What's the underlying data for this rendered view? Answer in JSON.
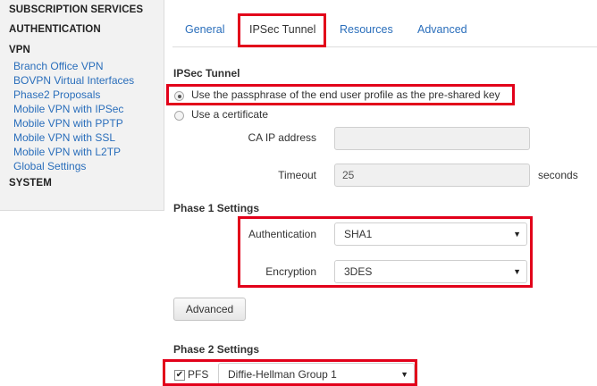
{
  "sidebar": {
    "sections": [
      {
        "label": "SUBSCRIPTION SERVICES"
      },
      {
        "label": "AUTHENTICATION"
      },
      {
        "label": "VPN"
      }
    ],
    "vpn_items": [
      "Branch Office VPN",
      "BOVPN Virtual Interfaces",
      "Phase2 Proposals",
      "Mobile VPN with IPSec",
      "Mobile VPN with PPTP",
      "Mobile VPN with SSL",
      "Mobile VPN with L2TP",
      "Global Settings"
    ],
    "system_label": "SYSTEM"
  },
  "tabs": [
    {
      "label": "General",
      "active": false
    },
    {
      "label": "IPSec Tunnel",
      "active": true
    },
    {
      "label": "Resources",
      "active": false
    },
    {
      "label": "Advanced",
      "active": false
    }
  ],
  "ipsec": {
    "heading": "IPSec Tunnel",
    "option_passphrase": "Use the passphrase of the end user profile as the pre-shared key",
    "option_certificate": "Use a certificate",
    "selected_option": "passphrase",
    "ca_ip_label": "CA IP address",
    "ca_ip_value": "",
    "timeout_label": "Timeout",
    "timeout_value": "25",
    "timeout_unit": "seconds"
  },
  "phase1": {
    "heading": "Phase 1 Settings",
    "authentication_label": "Authentication",
    "authentication_value": "SHA1",
    "encryption_label": "Encryption",
    "encryption_value": "3DES",
    "advanced_button": "Advanced"
  },
  "phase2": {
    "heading": "Phase 2 Settings",
    "pfs_label": "PFS",
    "pfs_checked": true,
    "pfs_group_value": "Diffie-Hellman Group 1"
  },
  "icons": {
    "dropdown_arrow": "▼",
    "checkmark": "✔"
  },
  "colors": {
    "link": "#2a6ebb",
    "highlight": "#e2001a",
    "sidebar_bg": "#f2f2f2"
  }
}
